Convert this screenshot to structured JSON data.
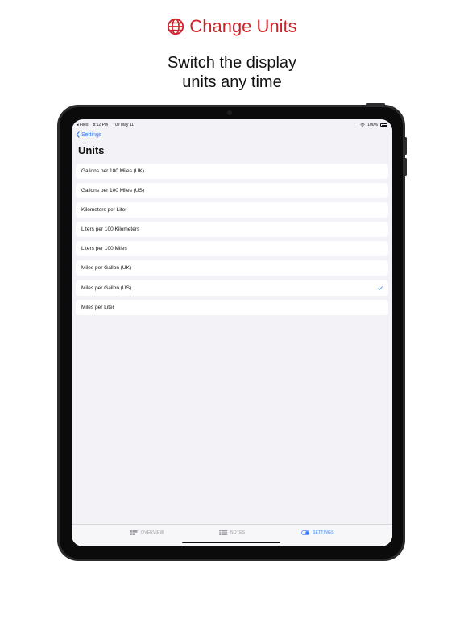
{
  "promo": {
    "title": "Change Units",
    "subtitle_line1": "Switch the display",
    "subtitle_line2": "units any time",
    "accent_color": "#d0222a",
    "title_icon": "globe-icon"
  },
  "statusbar": {
    "back_app": "◂ Files",
    "time": "8:12 PM",
    "date": "Tue May 11",
    "battery": "100%"
  },
  "nav": {
    "back_label": "Settings",
    "title": "Units"
  },
  "units": [
    {
      "label": "Gallons per 100 Miles (UK)",
      "selected": false
    },
    {
      "label": "Gallons per 100 Miles (US)",
      "selected": false
    },
    {
      "label": "Kilometers per Liter",
      "selected": false
    },
    {
      "label": "Liters per 100 Kilometers",
      "selected": false
    },
    {
      "label": "Liters per 100 Miles",
      "selected": false
    },
    {
      "label": "Miles per Gallon (UK)",
      "selected": false
    },
    {
      "label": "Miles per Gallon (US)",
      "selected": true
    },
    {
      "label": "Miles per Liter",
      "selected": false
    }
  ],
  "tabs": {
    "overview": "OVERVIEW",
    "notes": "NOTES",
    "settings": "SETTINGS",
    "active": "settings"
  },
  "colors": {
    "tint": "#2f7cf6",
    "background": "#f2f2f7"
  }
}
